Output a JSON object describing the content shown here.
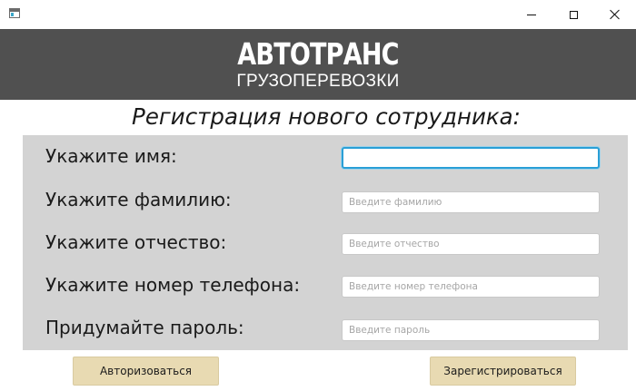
{
  "window": {
    "controls": {
      "minimize_icon": "minimize-icon",
      "maximize_icon": "maximize-icon",
      "close_icon": "close-icon"
    }
  },
  "header": {
    "brand": "АВТОТРАНС",
    "subtitle": "ГРУЗОПЕРЕВОЗКИ",
    "background": "#505050"
  },
  "form": {
    "title": "Регистрация нового сотрудника:",
    "fields": [
      {
        "label": "Укажите имя:",
        "value": "",
        "placeholder": ""
      },
      {
        "label": "Укажите фамилию:",
        "value": "",
        "placeholder": "Введите фамилию"
      },
      {
        "label": "Укажите отчество:",
        "value": "",
        "placeholder": "Введите отчество"
      },
      {
        "label": "Укажите номер телефона:",
        "value": "",
        "placeholder": "Введите номер телефона"
      },
      {
        "label": "Придумайте пароль:",
        "value": "",
        "placeholder": "Введите пароль"
      }
    ],
    "panel_color": "#d3d3d3",
    "focus_color": "#2a9fd6"
  },
  "actions": {
    "login_label": "Авторизоваться",
    "register_label": "Зарегистрироваться",
    "button_color": "#e8dab2"
  }
}
